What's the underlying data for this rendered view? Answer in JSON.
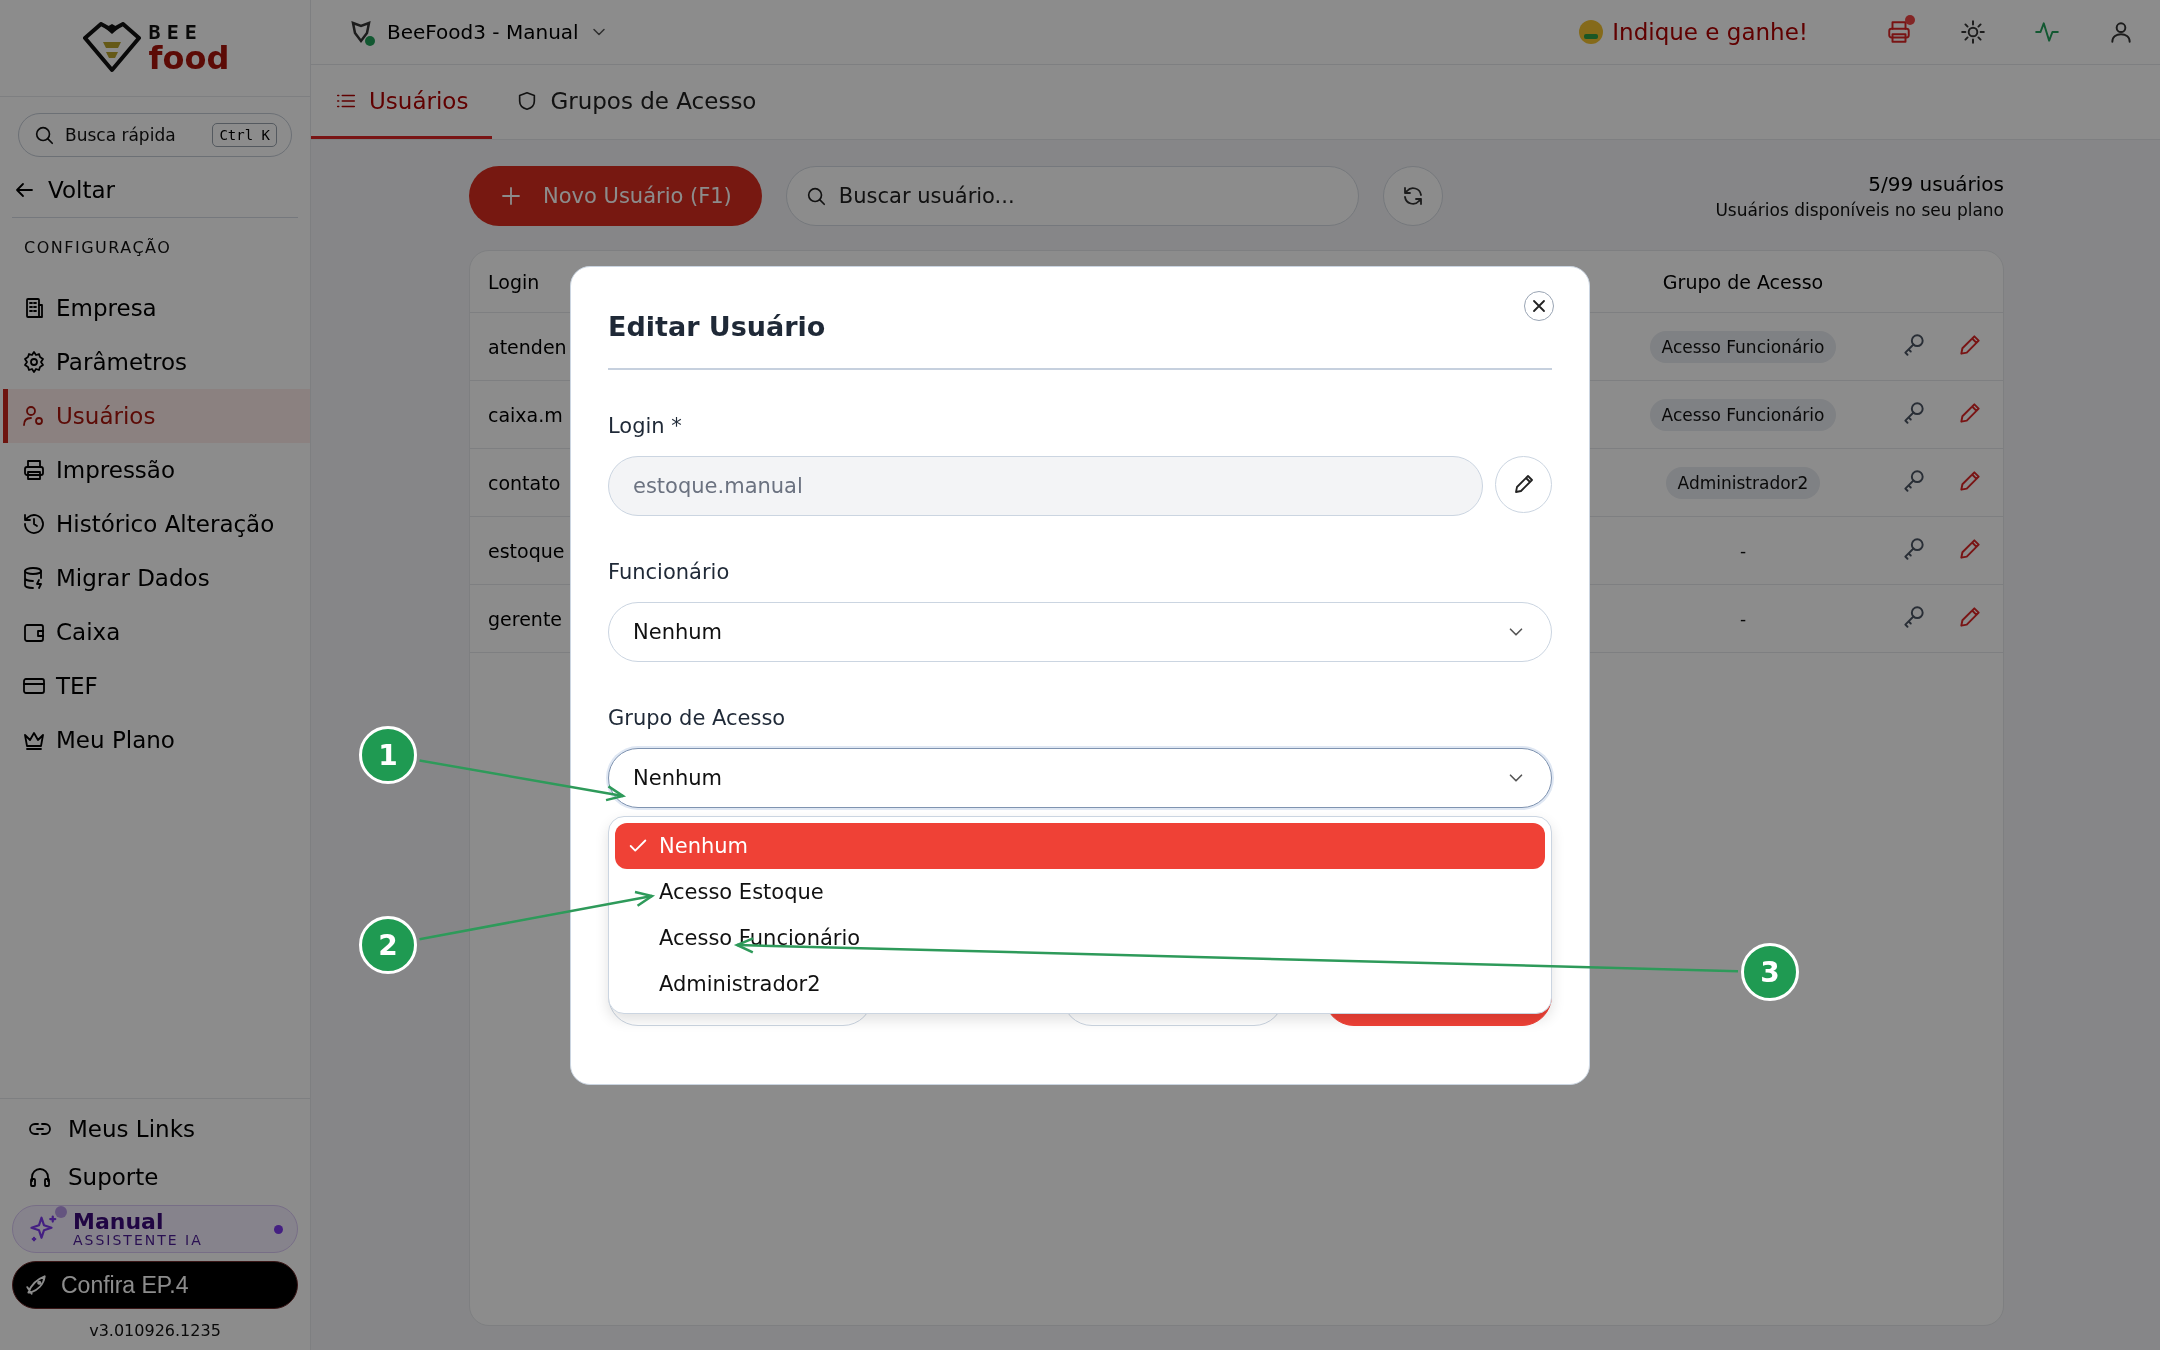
{
  "sidebar": {
    "logo": {
      "top": "BEE",
      "bottom": "food"
    },
    "search": {
      "placeholder": "Busca rápida",
      "shortcut": "Ctrl K"
    },
    "back": "Voltar",
    "section": "CONFIGURAÇÃO",
    "items": [
      {
        "label": "Empresa",
        "selected": false
      },
      {
        "label": "Parâmetros",
        "selected": false
      },
      {
        "label": "Usuários",
        "selected": true
      },
      {
        "label": "Impressão",
        "selected": false
      },
      {
        "label": "Histórico Alteração",
        "selected": false
      },
      {
        "label": "Migrar Dados",
        "selected": false
      },
      {
        "label": "Caixa",
        "selected": false
      },
      {
        "label": "TEF",
        "selected": false
      },
      {
        "label": "Meu Plano",
        "selected": false
      }
    ],
    "footer_links": [
      {
        "label": "Meus Links"
      },
      {
        "label": "Suporte"
      }
    ],
    "assistant": {
      "title": "Manual",
      "subtitle": "ASSISTENTE IA"
    },
    "promo": "Confira EP.4",
    "version": "v3.010926.1235"
  },
  "topbar": {
    "workspace": "BeeFood3 - Manual",
    "referral": "Indique e ganhe!"
  },
  "tabs": [
    {
      "label": "Usuários",
      "selected": true
    },
    {
      "label": "Grupos de Acesso",
      "selected": false
    }
  ],
  "toolbar": {
    "new_button": "Novo Usuário (F1)",
    "search_placeholder": "Buscar usuário...",
    "count": "5/99 usuários",
    "count_note": "Usuários disponíveis no seu plano"
  },
  "table": {
    "columns": [
      "Login",
      "Grupo de Acesso"
    ],
    "rows": [
      {
        "login": "atenden",
        "group": "Acesso Funcionário"
      },
      {
        "login": "caixa.m",
        "group": "Acesso Funcionário"
      },
      {
        "login": "contato",
        "group": "Administrador2"
      },
      {
        "login": "estoque",
        "group": "-"
      },
      {
        "login": "gerente",
        "group": "-"
      }
    ]
  },
  "modal": {
    "title": "Editar Usuário",
    "fields": [
      {
        "kind": "text",
        "label": "Login *",
        "value": "estoque.manual",
        "disabled": true
      },
      {
        "kind": "select",
        "label": "Funcionário",
        "value": "Nenhum",
        "expanded": false
      },
      {
        "kind": "select",
        "label": "Grupo de Acesso",
        "value": "Nenhum",
        "expanded": true,
        "options": [
          {
            "label": "Nenhum",
            "selected": true
          },
          {
            "label": "Acesso Estoque",
            "selected": false
          },
          {
            "label": "Acesso Funcionário",
            "selected": false
          },
          {
            "label": "Administrador2",
            "selected": false
          }
        ]
      }
    ]
  },
  "annotations": [
    {
      "label": "1"
    },
    {
      "label": "2"
    },
    {
      "label": "3"
    }
  ]
}
